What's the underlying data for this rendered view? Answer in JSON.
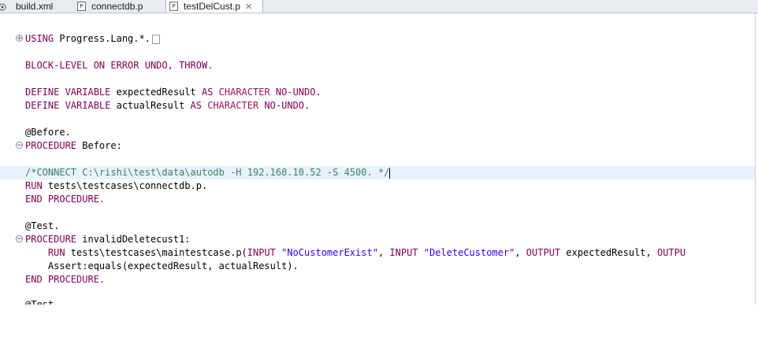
{
  "tabs": [
    {
      "label": "build.xml"
    },
    {
      "label": "connectdb.p"
    },
    {
      "label": "testDelCust.p",
      "close": "✕"
    }
  ],
  "code": {
    "l1_kw": "USING",
    "l1_rest": " Progress.Lang.*.",
    "l2_kw": "BLOCK-LEVEL ON ERROR UNDO, THROW.",
    "l3_a": "DEFINE VARIABLE",
    "l3_b": " expectedResult ",
    "l3_c": "AS",
    "l3_d": " CHARACTER",
    "l3_e": " NO-UNDO.",
    "l4_a": "DEFINE VARIABLE",
    "l4_b": " actualResult ",
    "l4_c": "AS",
    "l4_d": " CHARACTER",
    "l4_e": " NO-UNDO.",
    "l5": "@Before.",
    "l6_kw": "PROCEDURE",
    "l6_rest": " Before:",
    "l7_cmt": "/*CONNECT C:\\rishi\\test\\data\\autodb -H 192.168.10.52 -S 4500. */",
    "l8_kw": "RUN",
    "l8_rest": " tests\\testcases\\connectdb.p.",
    "l9_kw": "END PROCEDURE.",
    "l10": "@Test.",
    "l11_kw": "PROCEDURE",
    "l11_rest": " invalidDeletecust1:",
    "l12_a": "    RUN",
    "l12_b": " tests\\testcases\\maintestcase.p(",
    "l12_c": "INPUT",
    "l12_d": " \"NoCustomerExist\"",
    "l12_e": ", ",
    "l12_f": "INPUT",
    "l12_g": " \"DeleteCustomer\"",
    "l12_h": ", ",
    "l12_i": "OUTPUT",
    "l12_j": " expectedResult, ",
    "l12_k": "OUTPU",
    "l13_a": "    Assert:equals(expectedResult, actualResult).",
    "l14_kw": "END PROCEDURE.",
    "l15": "@Test."
  }
}
